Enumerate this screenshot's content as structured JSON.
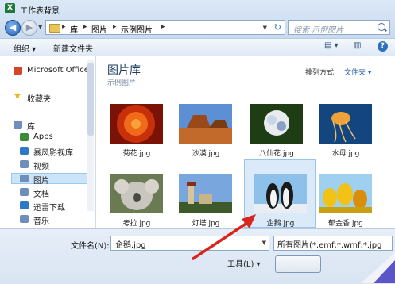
{
  "window": {
    "title": "工作表背景",
    "app_icon_letter": "X"
  },
  "address": {
    "crumbs": [
      "库",
      "图片",
      "示例图片"
    ],
    "search_placeholder": "搜索 示例图片"
  },
  "toolbar": {
    "organize": "组织 ▾",
    "new_folder": "新建文件夹"
  },
  "nav": {
    "items": [
      {
        "label": "Microsoft Office",
        "icon": "office-icon",
        "color": "#d24726"
      },
      {
        "label": "收藏夹",
        "icon": "star-icon",
        "color": "#e7b416"
      },
      {
        "label": "库",
        "icon": "library-icon",
        "color": "#6e8fb9"
      },
      {
        "label": "Apps",
        "icon": "apps-icon",
        "color": "#3a8a3a"
      },
      {
        "label": "暴风影视库",
        "icon": "video-lib-icon",
        "color": "#2f78c4"
      },
      {
        "label": "视频",
        "icon": "video-icon",
        "color": "#6e8fb9"
      },
      {
        "label": "图片",
        "icon": "pictures-icon",
        "color": "#6e8fb9"
      },
      {
        "label": "文档",
        "icon": "documents-icon",
        "color": "#6e8fb9"
      },
      {
        "label": "迅雷下载",
        "icon": "thunder-icon",
        "color": "#2f78c4"
      },
      {
        "label": "音乐",
        "icon": "music-icon",
        "color": "#6e8fb9"
      }
    ],
    "selected": "图片"
  },
  "main": {
    "library_title": "图片库",
    "library_subtitle": "示例图片",
    "arrange_label": "排列方式:",
    "arrange_value": "文件夹 ▾",
    "files": [
      {
        "name": "菊花.jpg",
        "colors": [
          "#c8300a",
          "#f06a1a",
          "#7a1205"
        ]
      },
      {
        "name": "沙漠.jpg",
        "colors": [
          "#5d8fd4",
          "#c26a2c",
          "#7a3a12"
        ]
      },
      {
        "name": "八仙花.jpg",
        "colors": [
          "#1f3d14",
          "#e8ecef",
          "#8aa0c8"
        ]
      },
      {
        "name": "水母.jpg",
        "colors": [
          "#0b2a52",
          "#f0a23a",
          "#13457e"
        ]
      },
      {
        "name": "考拉.jpg",
        "colors": [
          "#6a7a52",
          "#c9c6bf",
          "#4a4a44"
        ]
      },
      {
        "name": "灯塔.jpg",
        "colors": [
          "#78a6dd",
          "#d9c49a",
          "#3e5a2a"
        ]
      },
      {
        "name": "企鹅.jpg",
        "colors": [
          "#8ec1ea",
          "#1a1a1a",
          "#e8eef4"
        ]
      },
      {
        "name": "郁金香.jpg",
        "colors": [
          "#f2c214",
          "#9fd0f0",
          "#d98f0c"
        ]
      }
    ],
    "selected_file": "企鹅.jpg"
  },
  "bottom": {
    "filename_label": "文件名(N):",
    "filename_value": "企鹅.jpg",
    "filetype_value": "所有图片(*.emf;*.wmf;*.jpg",
    "tools_label": "工具(L) ▾"
  },
  "colors": {
    "accent": "#2f6fc0",
    "annotation_arrow": "#d9261c"
  }
}
